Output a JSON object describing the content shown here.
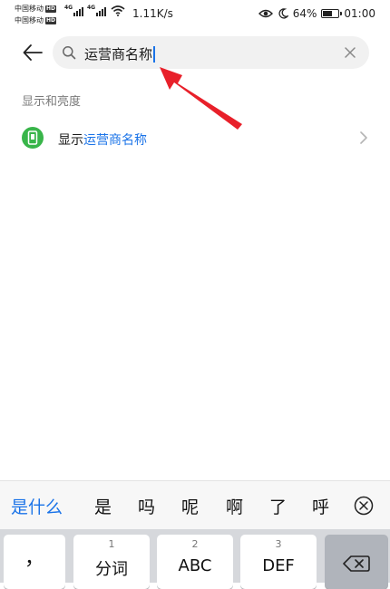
{
  "status_bar": {
    "carrier1": "中国移动",
    "carrier2": "中国移动",
    "hd": "HD",
    "net_type": "4G",
    "net_speed": "1.11K/s",
    "battery_percent": "64%",
    "battery_level": 0.64,
    "time": "01:00",
    "icons": [
      "signal-icon",
      "wifi-icon",
      "eye-comfort-icon",
      "moon-icon",
      "battery-icon"
    ]
  },
  "search": {
    "query": "运营商名称"
  },
  "results": {
    "section_title": "显示和亮度",
    "items": [
      {
        "prefix": "显示",
        "highlight": "运营商名称",
        "icon": "display-icon"
      }
    ]
  },
  "ime": {
    "candidates": [
      "是什么",
      "是",
      "吗",
      "呢",
      "啊",
      "了",
      "呼"
    ]
  },
  "keyboard": {
    "keys": [
      {
        "num": "",
        "label": "，"
      },
      {
        "num": "1",
        "label": "分词"
      },
      {
        "num": "2",
        "label": "ABC"
      },
      {
        "num": "3",
        "label": "DEF"
      }
    ]
  },
  "colors": {
    "accent": "#1a73e8",
    "icon_green": "#39b54a",
    "annotation": "#e8202a"
  }
}
